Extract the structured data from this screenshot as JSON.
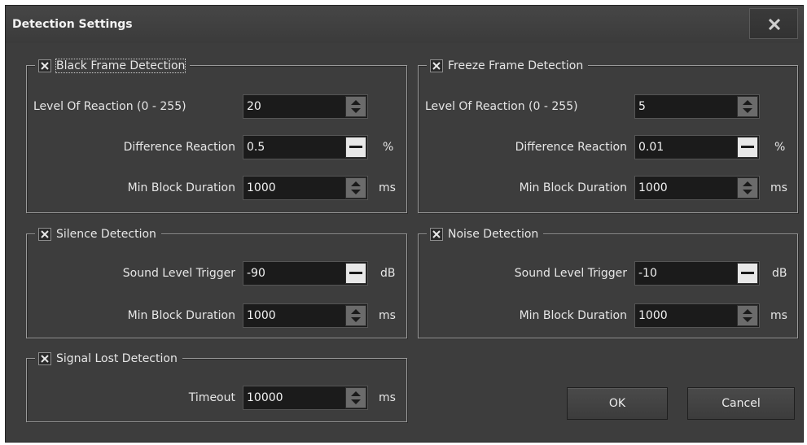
{
  "window": {
    "title": "Detection Settings",
    "close_icon": "close-icon"
  },
  "black_frame": {
    "title": "Black Frame Detection",
    "checked": true,
    "level_label": "Level Of Reaction (0 - 255)",
    "level_value": "20",
    "diff_label": "Difference Reaction",
    "diff_value": "0.5",
    "diff_unit": "%",
    "min_label": "Min Block Duration",
    "min_value": "1000",
    "min_unit": "ms"
  },
  "freeze_frame": {
    "title": "Freeze Frame Detection",
    "checked": true,
    "level_label": "Level Of Reaction (0 - 255)",
    "level_value": "5",
    "diff_label": "Difference Reaction",
    "diff_value": "0.01",
    "diff_unit": "%",
    "min_label": "Min Block Duration",
    "min_value": "1000",
    "min_unit": "ms"
  },
  "silence": {
    "title": "Silence Detection",
    "checked": true,
    "sound_label": "Sound Level Trigger",
    "sound_value": "-90",
    "sound_unit": "dB",
    "min_label": "Min Block Duration",
    "min_value": "1000",
    "min_unit": "ms"
  },
  "noise": {
    "title": "Noise Detection",
    "checked": true,
    "sound_label": "Sound Level Trigger",
    "sound_value": "-10",
    "sound_unit": "dB",
    "min_label": "Min Block Duration",
    "min_value": "1000",
    "min_unit": "ms"
  },
  "signal_lost": {
    "title": "Signal Lost Detection",
    "checked": true,
    "timeout_label": "Timeout",
    "timeout_value": "10000",
    "timeout_unit": "ms"
  },
  "buttons": {
    "ok": "OK",
    "cancel": "Cancel"
  },
  "colors": {
    "background": "#3d3d3d",
    "field": "#1b1b1b",
    "text": "#e6e6e6"
  }
}
